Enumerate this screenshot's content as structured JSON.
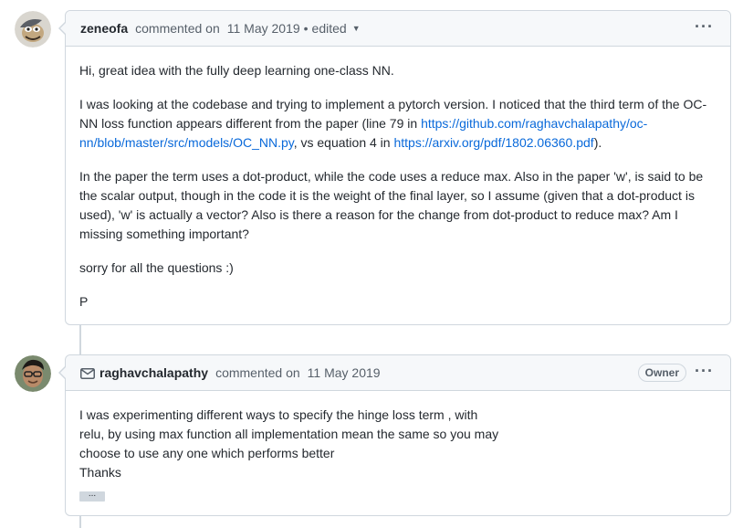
{
  "comments": [
    {
      "author": "zeneofa",
      "action": "commented on",
      "date": "11 May 2019",
      "edited": "edited",
      "caret_icon": "caret-down-icon",
      "menu_icon": "kebab-horizontal-icon",
      "paragraphs": {
        "p1": "Hi, great idea with the fully deep learning one-class NN.",
        "p2_a": "I was looking at the codebase and trying to implement a pytorch version. I noticed that the third term of the OC-NN loss function appears different from the paper (line 79 in ",
        "p2_link1": "https://github.com/raghavchalapathy/oc-nn/blob/master/src/models/OC_NN.py",
        "p2_b": ", vs equation 4 in ",
        "p2_link2": "https://arxiv.org/pdf/1802.06360.pdf",
        "p2_c": ").",
        "p3": "In the paper the term uses a dot-product, while the code uses a reduce max. Also in the paper 'w', is said to be the scalar output, though in the code it is the weight of the final layer, so I assume (given that a dot-product is used), 'w' is actually a vector? Also is there a reason for the change from dot-product to reduce max? Am I missing something important?",
        "p4": "sorry for all the questions :)",
        "p5": "P"
      }
    },
    {
      "author": "raghavchalapathy",
      "action": "commented on",
      "date": "11 May 2019",
      "badge": "Owner",
      "mail_icon": "mail-icon",
      "menu_icon": "kebab-horizontal-icon",
      "lines": {
        "l1": "I was experimenting different ways to specify the hinge loss term , with",
        "l2": "relu, by using max function all implementation mean the same so you may",
        "l3": "choose to use any one which performs better",
        "l4": "Thanks"
      },
      "hidden_toggle": "..."
    }
  ]
}
